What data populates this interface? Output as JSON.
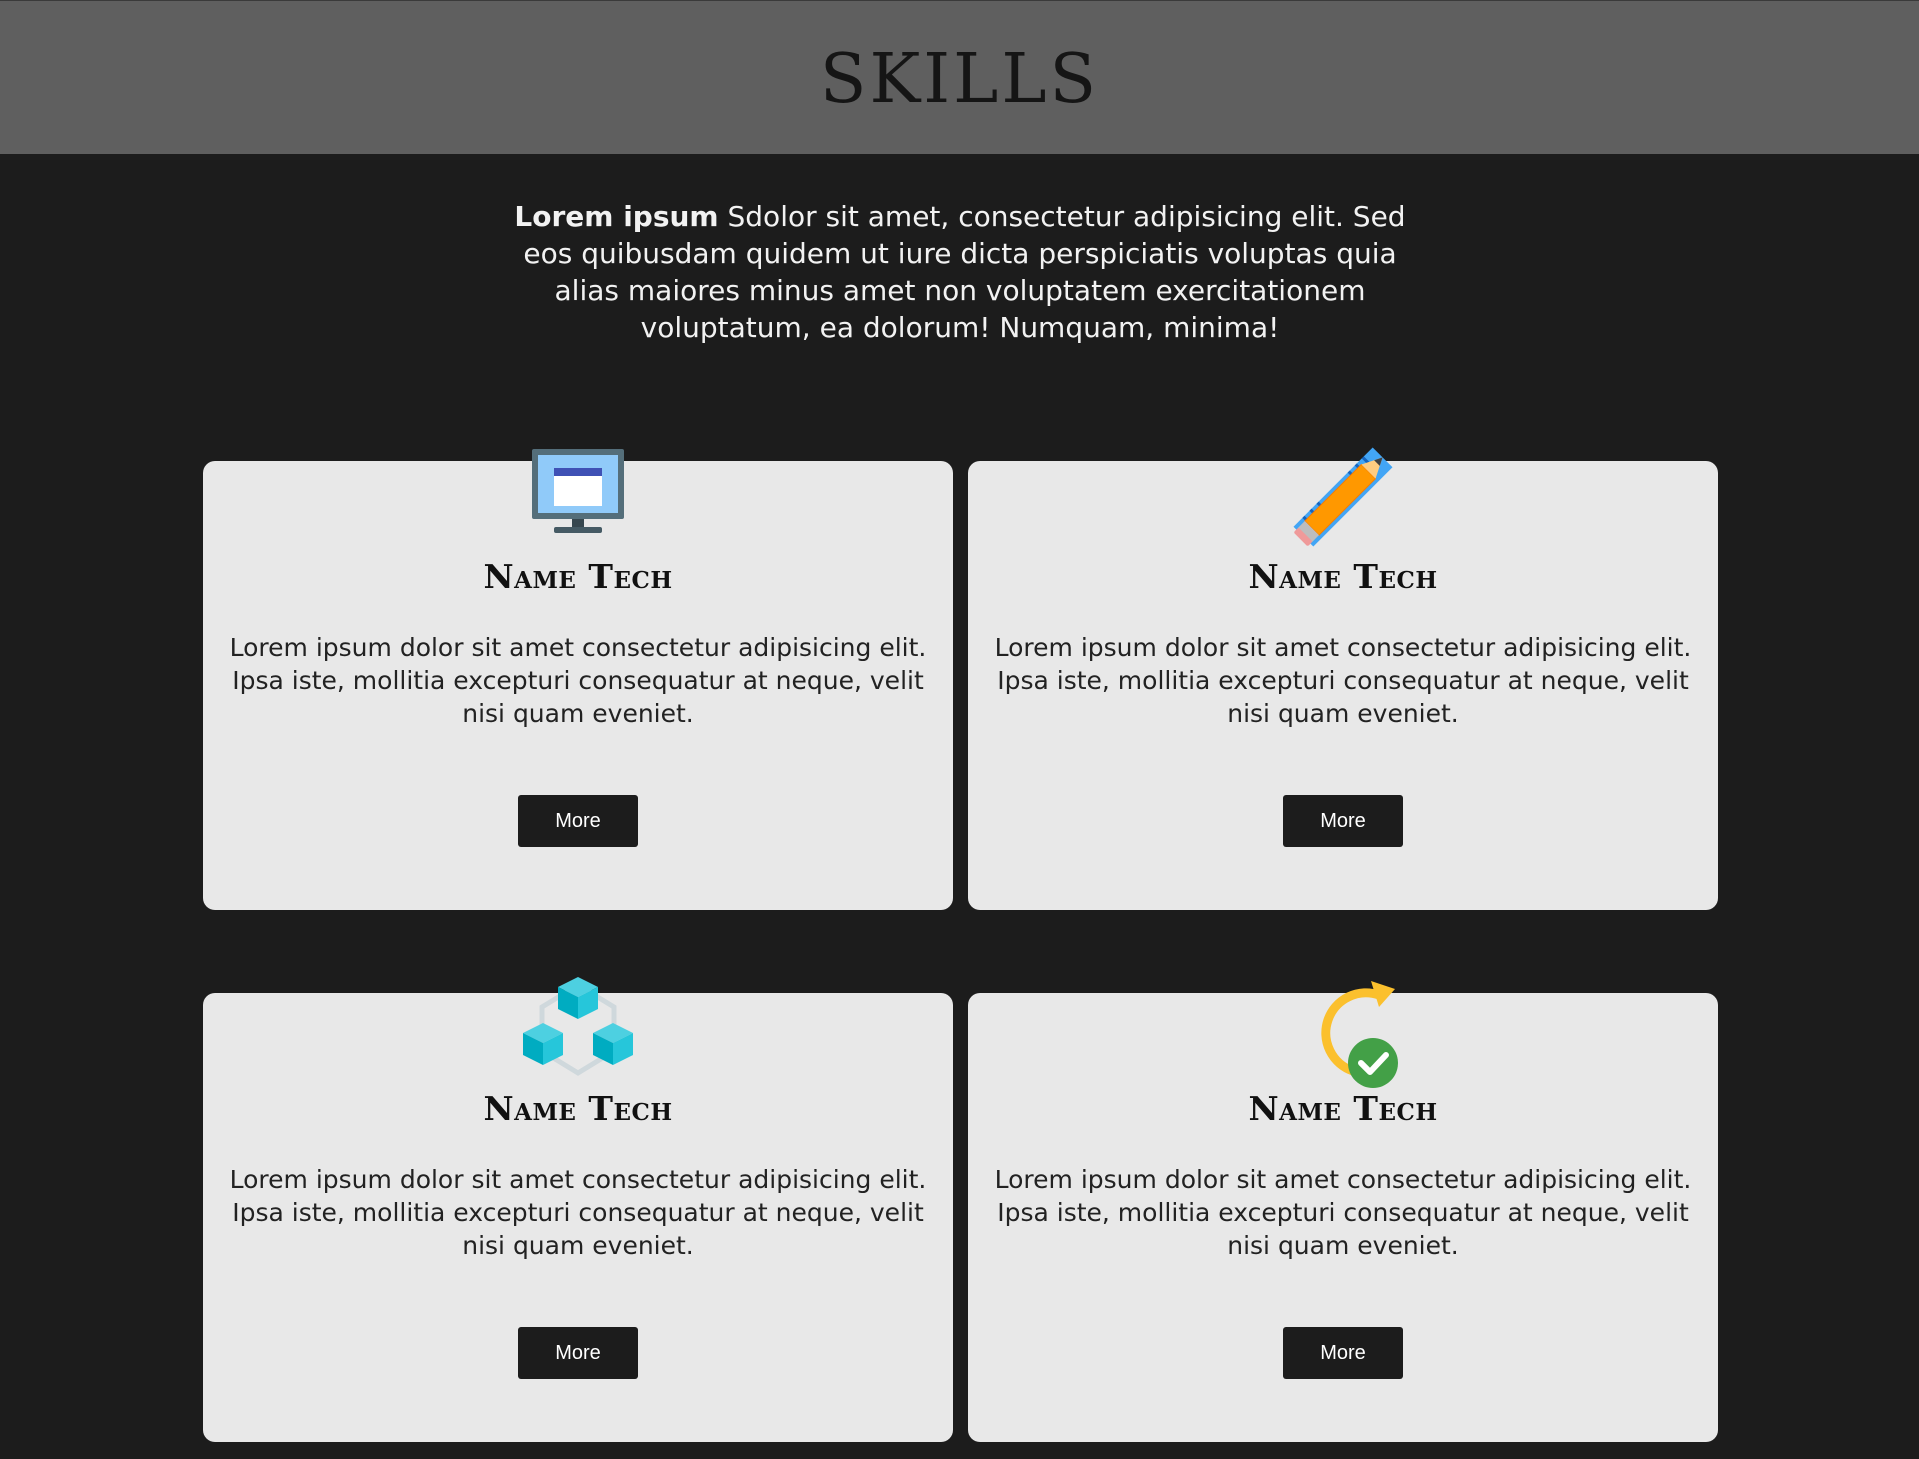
{
  "header": {
    "title": "SKILLS"
  },
  "intro": {
    "bold": "Lorem ipsum",
    "text": " Sdolor sit amet, consectetur adipisicing elit. Sed eos quibusdam quidem ut iure dicta perspiciatis voluptas quia alias maiores minus amet non voluptatem exercitationem voluptatum, ea dolorum! Numquam, minima!"
  },
  "cards": [
    {
      "icon": "monitor-icon",
      "title": "Name Tech",
      "description": "Lorem ipsum dolor sit amet consectetur adipisicing elit. Ipsa iste, mollitia excepturi consequatur at neque, velit nisi quam eveniet.",
      "button": "More"
    },
    {
      "icon": "pencil-ruler-icon",
      "title": "Name Tech",
      "description": "Lorem ipsum dolor sit amet consectetur adipisicing elit. Ipsa iste, mollitia excepturi consequatur at neque, velit nisi quam eveniet.",
      "button": "More"
    },
    {
      "icon": "cubes-icon",
      "title": "Name Tech",
      "description": "Lorem ipsum dolor sit amet consectetur adipisicing elit. Ipsa iste, mollitia excepturi consequatur at neque, velit nisi quam eveniet.",
      "button": "More"
    },
    {
      "icon": "refresh-check-icon",
      "title": "Name Tech",
      "description": "Lorem ipsum dolor sit amet consectetur adipisicing elit. Ipsa iste, mollitia excepturi consequatur at neque, velit nisi quam eveniet.",
      "button": "More"
    }
  ],
  "colors": {
    "header_bg": "#5f5f5f",
    "page_bg": "#1c1c1c",
    "card_bg": "#e8e8e8",
    "button_bg": "#1c1c1c"
  }
}
